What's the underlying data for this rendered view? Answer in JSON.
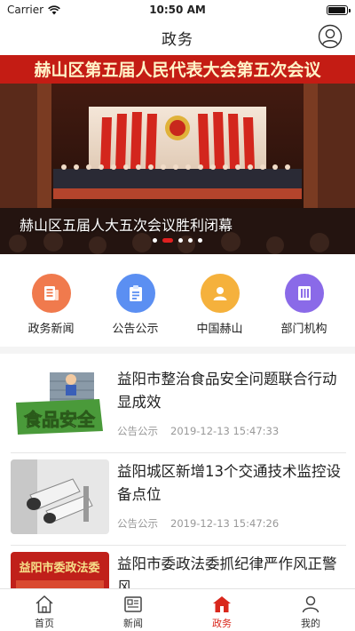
{
  "status": {
    "carrier": "Carrier",
    "time": "10:50 AM",
    "battery_level": 1.0
  },
  "nav": {
    "title": "政务",
    "user_icon": "user-circle-icon"
  },
  "banner": {
    "sign_text": "赫山区第五届人民代表大会第五次会议",
    "caption": "赫山区五届人大五次会议胜利闭幕",
    "slides": 5,
    "active_slide": 2
  },
  "quick_links": [
    {
      "label": "政务新闻",
      "icon": "news-icon",
      "color": "#f07a4d"
    },
    {
      "label": "公告公示",
      "icon": "clipboard-icon",
      "color": "#5b8ff2"
    },
    {
      "label": "中国赫山",
      "icon": "person-icon",
      "color": "#f5b13c"
    },
    {
      "label": "部门机构",
      "icon": "book-icon",
      "color": "#8a6ae8"
    }
  ],
  "news": [
    {
      "title": "益阳市整治食品安全问题联合行动显成效",
      "category": "公告公示",
      "time": "2019-12-13 15:47:33",
      "thumb": "食品安全"
    },
    {
      "title": "益阳城区新增13个交通技术监控设备点位",
      "category": "公告公示",
      "time": "2019-12-13 15:47:26",
      "thumb": ""
    },
    {
      "title": "益阳市委政法委抓纪律严作风正警风",
      "category": "",
      "time": "",
      "thumb": "益阳市委政法委"
    }
  ],
  "tabs": [
    {
      "label": "首页",
      "icon": "home-icon",
      "active": false
    },
    {
      "label": "新闻",
      "icon": "newspaper-icon",
      "active": false
    },
    {
      "label": "政务",
      "icon": "government-icon",
      "active": true
    },
    {
      "label": "我的",
      "icon": "profile-icon",
      "active": false
    }
  ],
  "colors": {
    "accent": "#d9271c",
    "meta": "#999999"
  }
}
